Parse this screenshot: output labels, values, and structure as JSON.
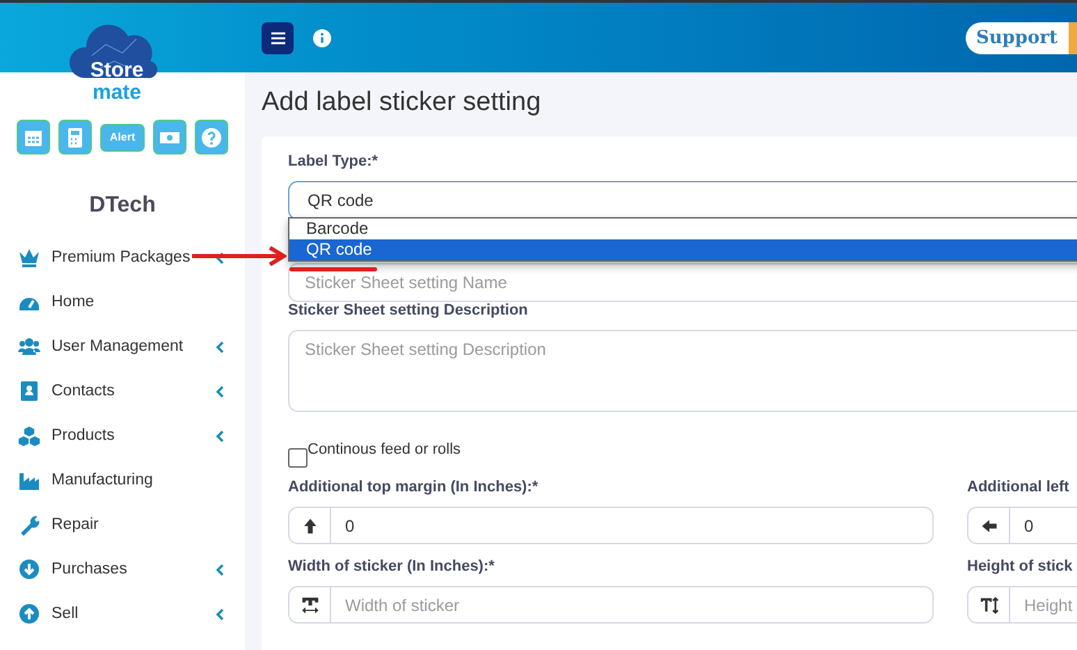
{
  "header": {
    "support_button": "Support"
  },
  "brand": {
    "line_1": "Store",
    "line_2": "mate"
  },
  "quick_buttons": [
    {
      "kind": "calendar"
    },
    {
      "kind": "calculator"
    },
    {
      "kind": "text",
      "label": "Alert"
    },
    {
      "kind": "money"
    },
    {
      "kind": "help"
    }
  ],
  "company": "DTech",
  "menu": [
    {
      "label": "Premium Packages",
      "kind": "crown",
      "has_submenu": true
    },
    {
      "label": "Home",
      "kind": "gauge",
      "has_submenu": false
    },
    {
      "label": "User Management",
      "kind": "users",
      "has_submenu": true
    },
    {
      "label": "Contacts",
      "kind": "contact",
      "has_submenu": true
    },
    {
      "label": "Products",
      "kind": "cubes",
      "has_submenu": true
    },
    {
      "label": "Manufacturing",
      "kind": "factory",
      "has_submenu": false
    },
    {
      "label": "Repair",
      "kind": "wrench",
      "has_submenu": false
    },
    {
      "label": "Purchases",
      "kind": "down",
      "has_submenu": true
    },
    {
      "label": "Sell",
      "kind": "up",
      "has_submenu": true
    }
  ],
  "page_title": "Add label sticker setting",
  "label_type": {
    "label": "Label Type:*",
    "value": "QR code",
    "options": [
      {
        "label": "Barcode",
        "selected": false
      },
      {
        "label": "QR code",
        "selected": true
      }
    ]
  },
  "name_field": {
    "placeholder": "Sticker Sheet setting Name"
  },
  "description": {
    "label": "Sticker Sheet setting Description",
    "placeholder": "Sticker Sheet setting Description"
  },
  "continuous": {
    "label": "Continous feed or rolls",
    "checked": false
  },
  "fields": [
    {
      "label": "Additional top margin (In Inches):*",
      "kind": "arrow-up",
      "value": "0"
    },
    {
      "label": "Additional left",
      "kind": "arrow-left",
      "value": "0"
    },
    {
      "label": "Width of sticker (In Inches):*",
      "kind": "width",
      "placeholder": "Width of sticker"
    },
    {
      "label": "Height of stick",
      "kind": "height",
      "placeholder": "Height"
    }
  ],
  "annotation_arrow": true,
  "annotation_underline": true
}
